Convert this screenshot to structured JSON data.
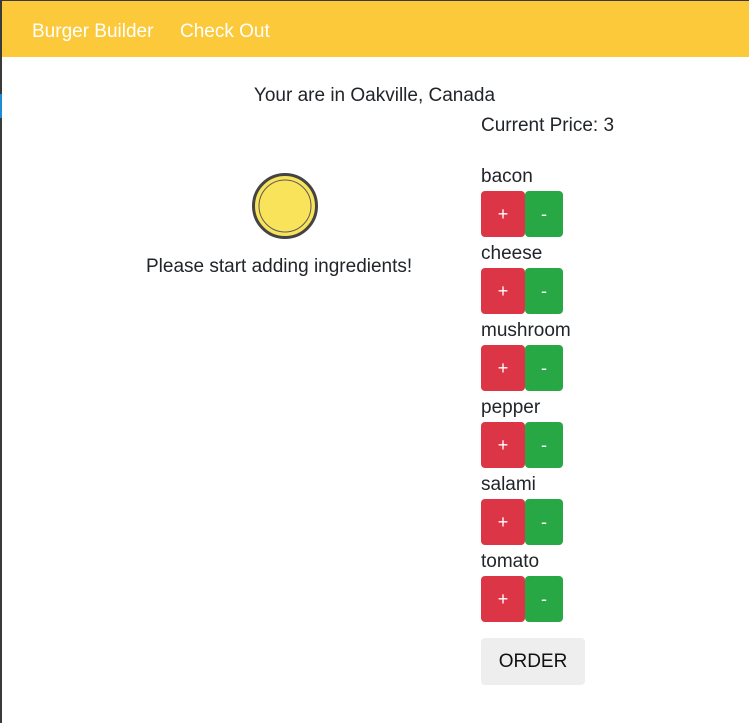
{
  "nav": {
    "brand": "Burger Builder",
    "checkout": "Check Out"
  },
  "location_text": "Your are in Oakville, Canada",
  "price_text": "Current Price: 3",
  "empty_message": "Please start adding ingredients!",
  "ingredients": [
    {
      "label": "bacon",
      "add": "+",
      "remove": "-"
    },
    {
      "label": "cheese",
      "add": "+",
      "remove": "-"
    },
    {
      "label": "mushroom",
      "add": "+",
      "remove": "-"
    },
    {
      "label": "pepper",
      "add": "+",
      "remove": "-"
    },
    {
      "label": "salami",
      "add": "+",
      "remove": "-"
    },
    {
      "label": "tomato",
      "add": "+",
      "remove": "-"
    }
  ],
  "order_label": "ORDER",
  "colors": {
    "navbar": "#fcc93a",
    "add_button": "#dc3545",
    "remove_button": "#28a745",
    "bun_fill": "#f9e35a"
  },
  "icons": {
    "bun": "burger-bun-icon"
  }
}
